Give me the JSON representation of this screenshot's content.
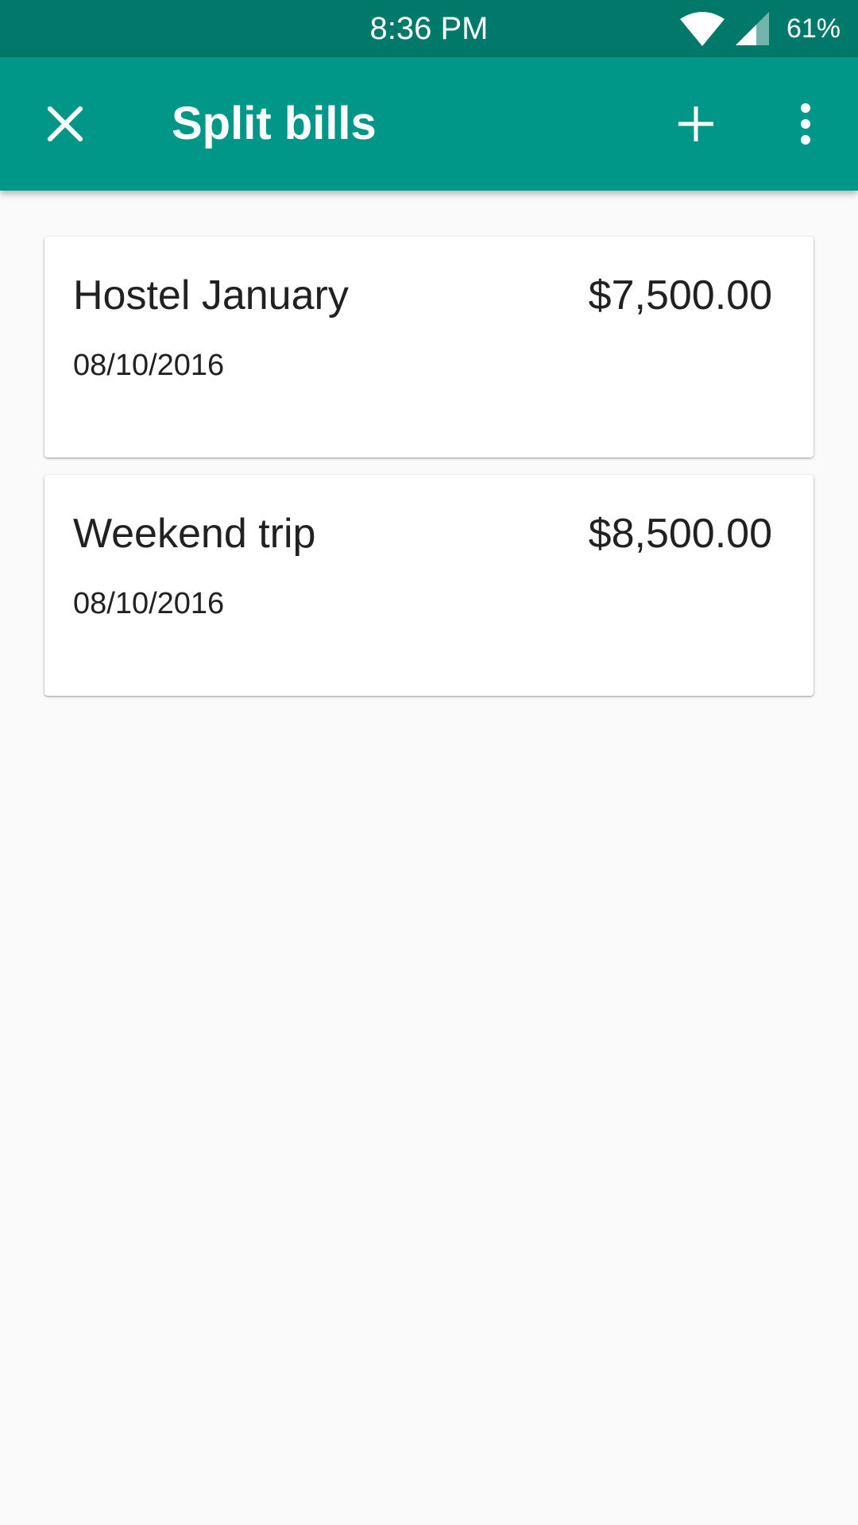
{
  "status_bar": {
    "time": "8:36 PM",
    "battery": "61%",
    "icons": [
      "wifi-icon",
      "signal-icon"
    ]
  },
  "app_bar": {
    "title": "Split bills",
    "close_icon": "close-icon",
    "add_icon": "add-icon",
    "more_icon": "more-vert-icon",
    "color": "#009688",
    "status_color": "#00796b"
  },
  "bills": [
    {
      "name": "Hostel January",
      "amount": "$7,500.00",
      "date": "08/10/2016"
    },
    {
      "name": "Weekend trip",
      "amount": "$8,500.00",
      "date": "08/10/2016"
    }
  ]
}
